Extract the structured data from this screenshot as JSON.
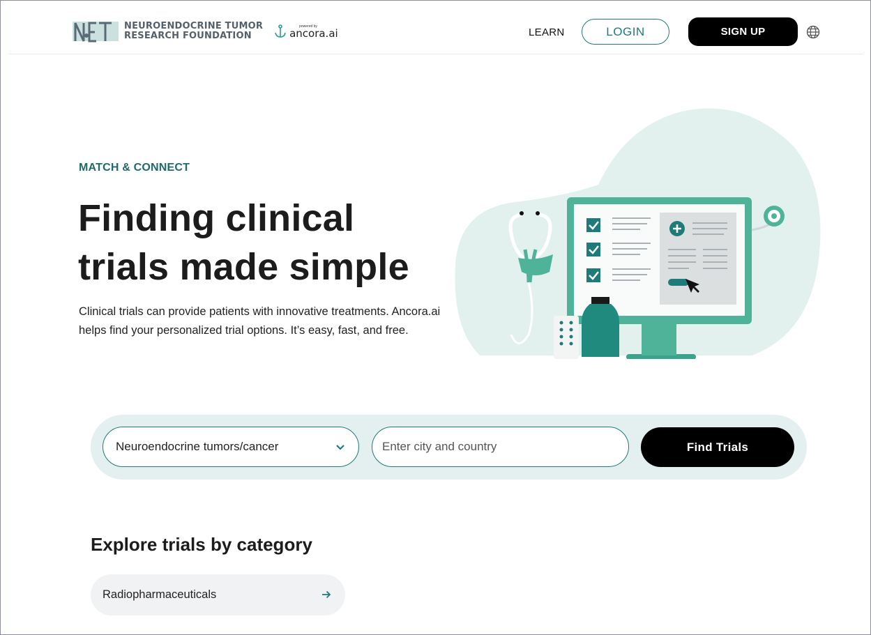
{
  "header": {
    "logo_line1": "NEUROENDOCRINE TUMOR",
    "logo_line2": "RESEARCH FOUNDATION",
    "logo_mark_text": "NET",
    "powered_by_small": "powered by",
    "powered_by_brand": "ancora.ai",
    "nav_learn": "LEARN",
    "login_label": "LOGIN",
    "signup_label": "SIGN UP",
    "globe_icon": "globe-icon"
  },
  "hero": {
    "eyebrow": "MATCH & CONNECT",
    "title": "Finding clinical trials made simple",
    "description": "Clinical trials can provide patients with innovative treatments. Ancora.ai helps find your personalized trial options. It’s easy, fast, and free."
  },
  "search": {
    "condition_selected": "Neuroendocrine tumors/cancer",
    "location_placeholder": "Enter city and country",
    "find_label": "Find Trials"
  },
  "categories": {
    "title": "Explore trials by category",
    "items": [
      {
        "label": "Radiopharmaceuticals"
      }
    ]
  },
  "colors": {
    "accent": "#1f7a7a",
    "accent_light": "#e3f0ef",
    "illustration_teal": "#4fb39a",
    "dark": "#000000"
  }
}
